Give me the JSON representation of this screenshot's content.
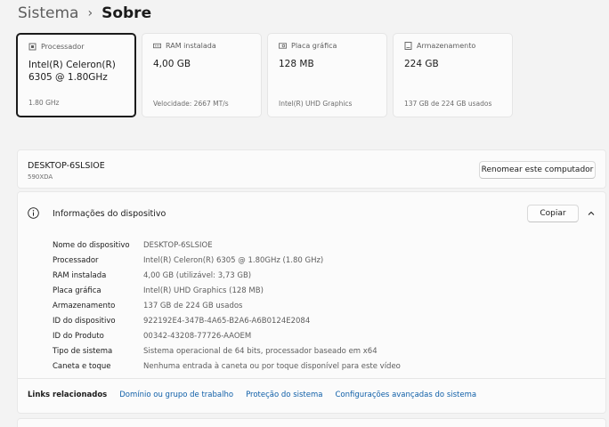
{
  "breadcrumb": {
    "parent": "Sistema",
    "separator": "›",
    "current": "Sobre"
  },
  "specs": [
    {
      "icon": "processor-icon",
      "title": "Processador",
      "value": "Intel(R) Celeron(R) 6305 @ 1.80GHz",
      "sub": "1.80 GHz",
      "selected": true
    },
    {
      "icon": "ram-icon",
      "title": "RAM instalada",
      "value": "4,00 GB",
      "sub": "Velocidade: 2667 MT/s"
    },
    {
      "icon": "graphics-card-icon",
      "title": "Placa gráfica",
      "value": "128 MB",
      "sub": "Intel(R) UHD Graphics"
    },
    {
      "icon": "storage-icon",
      "title": "Armazenamento",
      "value": "224 GB",
      "sub": "137 GB de 224 GB usados"
    }
  ],
  "device": {
    "name": "DESKTOP-6SLSIOE",
    "model": "590XDA",
    "rename_label": "Renomear este computador"
  },
  "info": {
    "title": "Informações do dispositivo",
    "copy_label": "Copiar",
    "rows": [
      {
        "label": "Nome do dispositivo",
        "value": "DESKTOP-6SLSIOE"
      },
      {
        "label": "Processador",
        "value": "Intel(R) Celeron(R) 6305 @ 1.80GHz (1.80 GHz)"
      },
      {
        "label": "RAM instalada",
        "value": "4,00 GB (utilizável: 3,73 GB)"
      },
      {
        "label": "Placa gráfica",
        "value": "Intel(R) UHD Graphics (128 MB)"
      },
      {
        "label": "Armazenamento",
        "value": "137 GB de 224 GB usados"
      },
      {
        "label": "ID do dispositivo",
        "value": "922192E4-347B-4A65-B2A6-A6B0124E2084"
      },
      {
        "label": "ID do Produto",
        "value": "00342-43208-77726-AAOEM"
      },
      {
        "label": "Tipo de sistema",
        "value": "Sistema operacional de 64 bits, processador baseado em x64"
      },
      {
        "label": "Caneta e toque",
        "value": "Nenhuma entrada à caneta ou por toque disponível para este vídeo"
      }
    ]
  },
  "related": {
    "label": "Links relacionados",
    "links": [
      "Domínio ou grupo de trabalho",
      "Proteção do sistema",
      "Configurações avançadas do sistema"
    ]
  },
  "colors": {
    "background": "#f3f3f3",
    "card": "#fbfbfb",
    "link": "#0f5fa8",
    "selected_border": "#1b1b1b"
  }
}
